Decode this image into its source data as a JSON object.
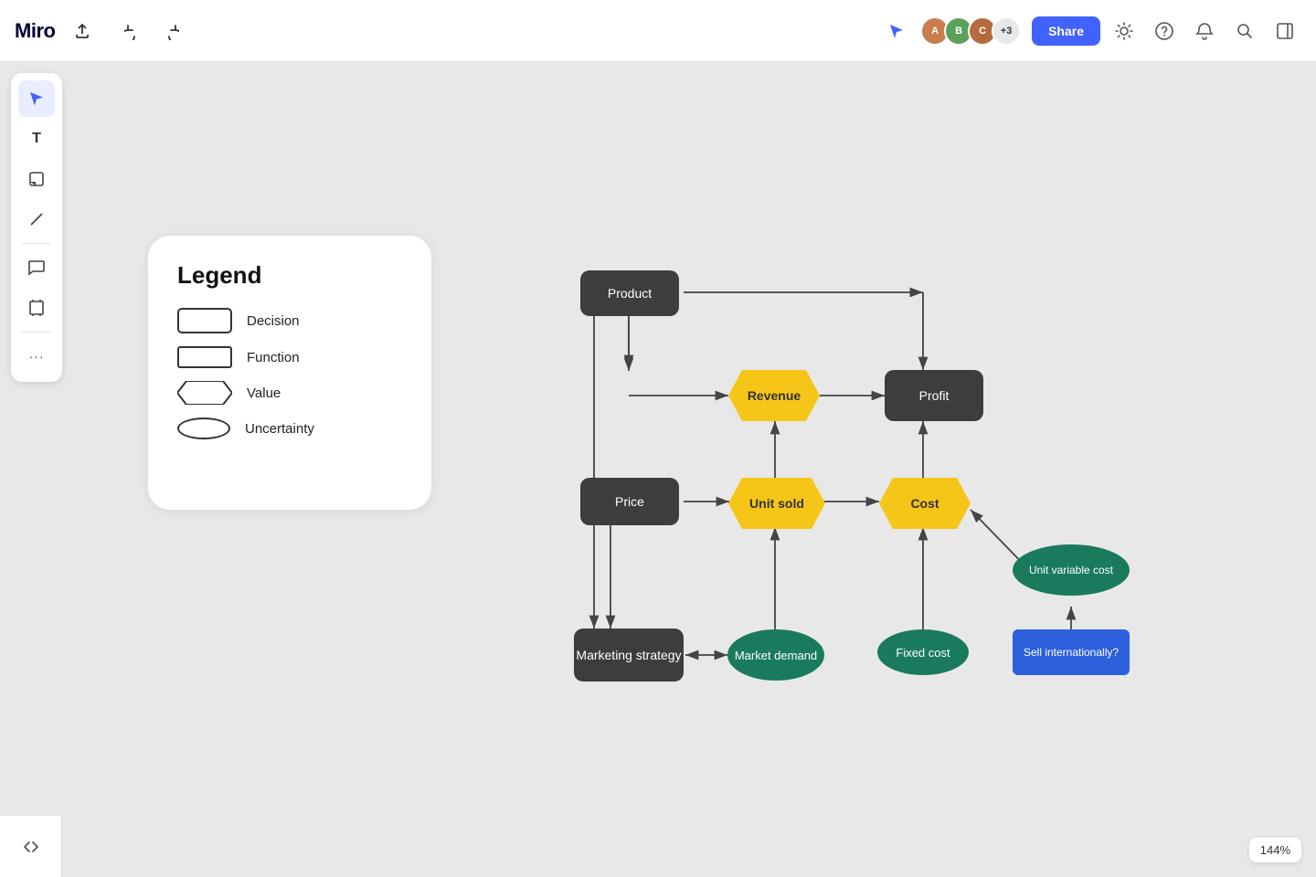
{
  "app": {
    "title": "Miro",
    "zoom": "144%"
  },
  "header": {
    "logo": "miro",
    "share_label": "Share",
    "avatar_count": "+3",
    "undo_icon": "↩",
    "redo_icon": "↪",
    "export_icon": "⬆",
    "settings_icon": "⚙",
    "help_icon": "?",
    "notification_icon": "🔔",
    "search_icon": "🔍",
    "panel_icon": "☰"
  },
  "toolbar": {
    "tools": [
      "cursor",
      "text",
      "sticky",
      "line",
      "comment",
      "frame",
      "more"
    ]
  },
  "legend": {
    "title": "Legend",
    "items": [
      {
        "label": "Decision",
        "shape": "decision"
      },
      {
        "label": "Function",
        "shape": "function"
      },
      {
        "label": "Value",
        "shape": "value"
      },
      {
        "label": "Uncertainty",
        "shape": "uncertainty"
      }
    ]
  },
  "diagram": {
    "nodes": {
      "product": "Product",
      "revenue": "Revenue",
      "profit": "Profit",
      "price": "Price",
      "unit_sold": "Unit sold",
      "cost": "Cost",
      "marketing_strategy": "Marketing strategy",
      "market_demand": "Market demand",
      "fixed_cost": "Fixed cost",
      "unit_variable_cost": "Unit variable cost",
      "sell_internationally": "Sell internationally?"
    }
  },
  "zoom_label": "144%",
  "expand_icon": "«"
}
